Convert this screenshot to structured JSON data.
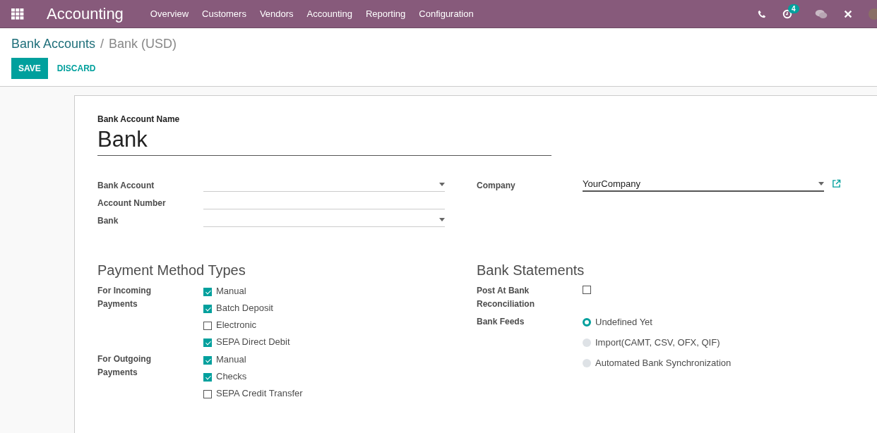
{
  "navbar": {
    "app_name": "Accounting",
    "menu": [
      "Overview",
      "Customers",
      "Vendors",
      "Accounting",
      "Reporting",
      "Configuration"
    ],
    "activity_badge": "4"
  },
  "breadcrumb": {
    "parent": "Bank Accounts",
    "separator": "/",
    "current": "Bank (USD)"
  },
  "buttons": {
    "save": "SAVE",
    "discard": "DISCARD"
  },
  "form": {
    "name_label": "Bank Account Name",
    "name_value": "Bank",
    "left_fields": [
      {
        "label": "Bank Account",
        "kind": "select"
      },
      {
        "label": "Account Number",
        "kind": "text"
      },
      {
        "label": "Bank",
        "kind": "select"
      }
    ],
    "company": {
      "label": "Company",
      "value": "YourCompany"
    },
    "payment_methods": {
      "title": "Payment Method Types",
      "groups": [
        {
          "label": "For Incoming Payments",
          "options": [
            {
              "label": "Manual",
              "checked": true
            },
            {
              "label": "Batch Deposit",
              "checked": true
            },
            {
              "label": "Electronic",
              "checked": false
            },
            {
              "label": "SEPA Direct Debit",
              "checked": true
            }
          ]
        },
        {
          "label": "For Outgoing Payments",
          "options": [
            {
              "label": "Manual",
              "checked": true
            },
            {
              "label": "Checks",
              "checked": true
            },
            {
              "label": "SEPA Credit Transfer",
              "checked": false
            }
          ]
        }
      ]
    },
    "bank_statements": {
      "title": "Bank Statements",
      "post_label": "Post At Bank Reconciliation",
      "post_checked": false,
      "feeds_label": "Bank Feeds",
      "feeds": [
        {
          "label": "Undefined Yet",
          "selected": true
        },
        {
          "label": "Import(CAMT, CSV, OFX, QIF)",
          "selected": false
        },
        {
          "label": "Automated Bank Synchronization",
          "selected": false
        }
      ]
    }
  }
}
